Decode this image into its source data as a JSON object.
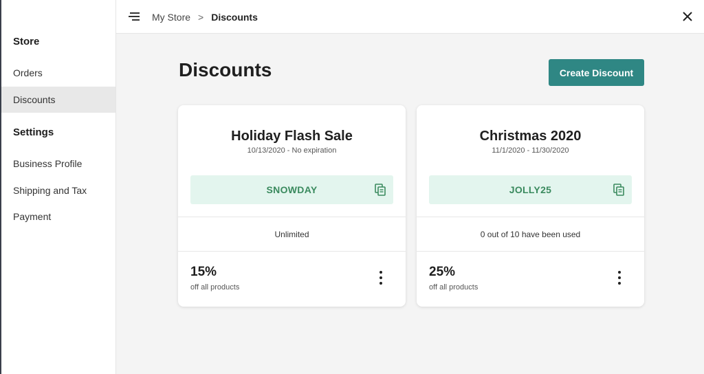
{
  "sidebar": {
    "store_title": "Store",
    "store_items": [
      {
        "label": "Orders"
      },
      {
        "label": "Discounts"
      }
    ],
    "settings_title": "Settings",
    "settings_items": [
      {
        "label": "Business Profile"
      },
      {
        "label": "Shipping and Tax"
      },
      {
        "label": "Payment"
      }
    ]
  },
  "topbar": {
    "menu_icon": "menu-icon",
    "breadcrumb": {
      "root": "My Store",
      "separator": ">",
      "current": "Discounts"
    },
    "close_icon": "close-icon"
  },
  "main": {
    "title": "Discounts",
    "create_button_label": "Create Discount",
    "cards": [
      {
        "title": "Holiday Flash Sale",
        "dates": "10/13/2020 - No expiration",
        "code": "SNOWDAY",
        "usage": "Unlimited",
        "percent": "15%",
        "scope": "off all products"
      },
      {
        "title": "Christmas 2020",
        "dates": "11/1/2020 - 11/30/2020",
        "code": "JOLLY25",
        "usage": "0 out of 10 have been used",
        "percent": "25%",
        "scope": "off all products"
      }
    ]
  },
  "colors": {
    "accent": "#2f8784",
    "code_bg": "#e3f5ee",
    "code_text": "#3a8a5e",
    "active_nav": "#e8e8e8",
    "page_bg": "#f4f4f4"
  }
}
